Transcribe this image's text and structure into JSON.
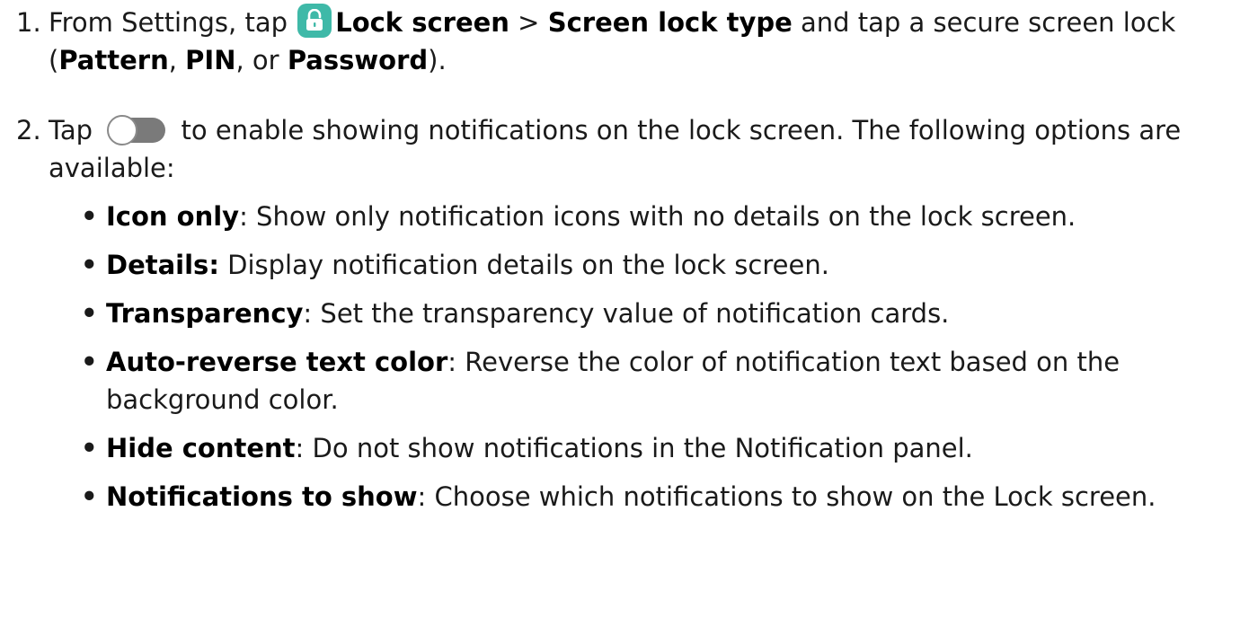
{
  "steps": [
    {
      "number": "1.",
      "prefix": "From Settings, tap ",
      "icon": "lock-icon",
      "link1": "Lock screen",
      "sep": " > ",
      "link2": "Screen lock type",
      "mid": " and tap a secure screen lock (",
      "opt1": "Pattern",
      "comma1": ", ",
      "opt2": "PIN",
      "comma2": ", or ",
      "opt3": "Password",
      "suffix": ")."
    },
    {
      "number": "2.",
      "prefix": "Tap ",
      "icon": "toggle-icon",
      "text": " to enable showing notifications on the lock screen. The following options are available:"
    }
  ],
  "options": [
    {
      "label": "Icon only",
      "desc": ": Show only notification icons with no details on the lock screen."
    },
    {
      "label": "Details:",
      "desc": " Display notification details on the lock screen."
    },
    {
      "label": "Transparency",
      "desc": ": Set the transparency value of notification cards."
    },
    {
      "label": "Auto-reverse text color",
      "desc": ": Reverse the color of notification text based on the background color."
    },
    {
      "label": "Hide content",
      "desc": ": Do not show notifications in the Notification panel."
    },
    {
      "label": "Notifications to show",
      "desc": ": Choose which notifications to show on the Lock screen."
    }
  ],
  "bullet_glyph": "•",
  "colors": {
    "lock_icon_bg": "#3fb9a8",
    "toggle_track": "#7a7a7a",
    "toggle_knob_border": "#8a8a8a"
  }
}
